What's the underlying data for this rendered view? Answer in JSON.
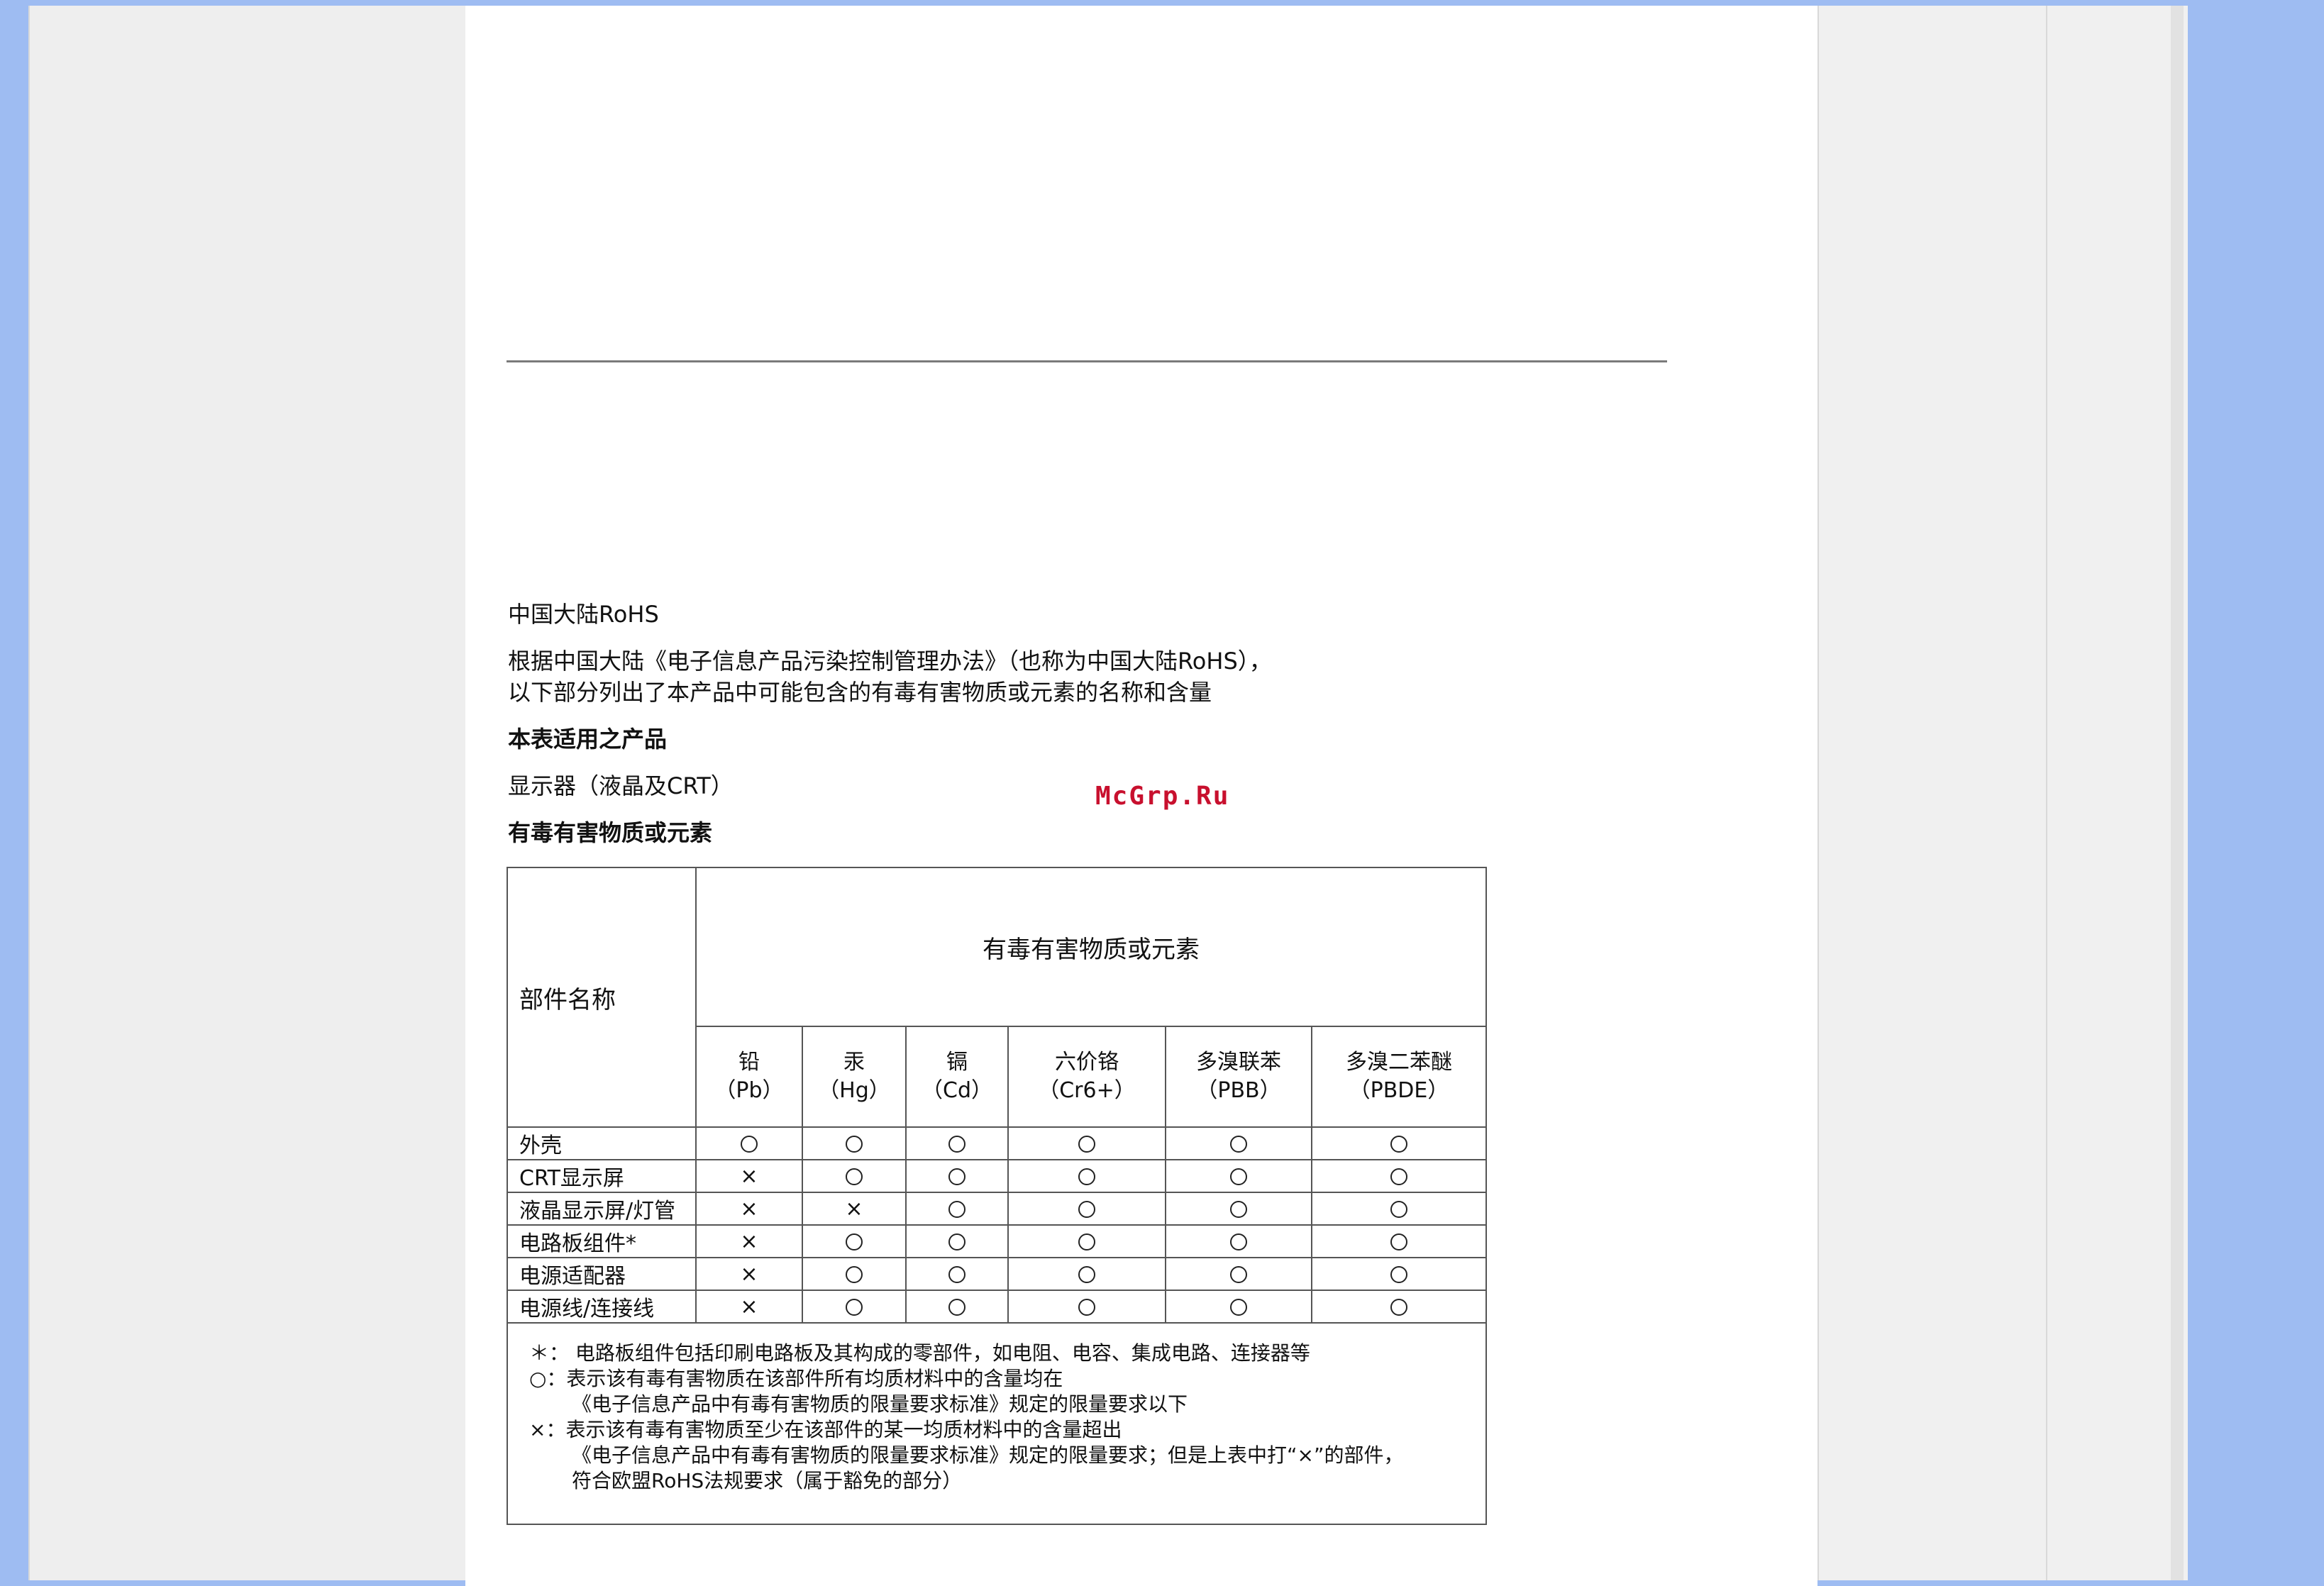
{
  "document": {
    "heading": "中国大陆RoHS",
    "intro_line1": "根据中国大陆《电子信息产品污染控制管理办法》（也称为中国大陆RoHS），",
    "intro_line2": "以下部分列出了本产品中可能包含的有毒有害物质或元素的名称和含量",
    "applies_label": "本表适用之产品",
    "product": "显示器（液晶及CRT）",
    "substances_label": "有毒有害物质或元素",
    "watermark": "McGrp.Ru"
  },
  "table": {
    "part_header": "部件名称",
    "group_header": "有毒有害物质或元素",
    "columns": [
      {
        "name": "铅",
        "symbol": "（Pb）"
      },
      {
        "name": "汞",
        "symbol": "（Hg）"
      },
      {
        "name": "镉",
        "symbol": "（Cd）"
      },
      {
        "name": "六价铬",
        "symbol": "（Cr6+）"
      },
      {
        "name": "多溴联苯",
        "symbol": "（PBB）"
      },
      {
        "name": "多溴二苯醚",
        "symbol": "（PBDE）"
      }
    ],
    "rows": [
      {
        "part": "外壳",
        "marks": [
          "○",
          "○",
          "○",
          "○",
          "○",
          "○"
        ]
      },
      {
        "part": "CRT显示屏",
        "marks": [
          "×",
          "○",
          "○",
          "○",
          "○",
          "○"
        ]
      },
      {
        "part": "液晶显示屏/灯管",
        "marks": [
          "×",
          "×",
          "○",
          "○",
          "○",
          "○"
        ]
      },
      {
        "part": "电路板组件*",
        "marks": [
          "×",
          "○",
          "○",
          "○",
          "○",
          "○"
        ]
      },
      {
        "part": "电源适配器",
        "marks": [
          "×",
          "○",
          "○",
          "○",
          "○",
          "○"
        ]
      },
      {
        "part": "电源线/连接线",
        "marks": [
          "×",
          "○",
          "○",
          "○",
          "○",
          "○"
        ]
      }
    ],
    "notes": [
      "＊：  电路板组件包括印刷电路板及其构成的零部件，如电阻、电容、集成电路、连接器等",
      "○：表示该有毒有害物质在该部件所有均质材料中的含量均在",
      "《电子信息产品中有毒有害物质的限量要求标准》规定的限量要求以下",
      "×：表示该有毒有害物质至少在该部件的某一均质材料中的含量超出",
      "《电子信息产品中有毒有害物质的限量要求标准》规定的限量要求；但是上表中打“×”的部件，",
      "符合欧盟RoHS法规要求（属于豁免的部分）"
    ]
  }
}
